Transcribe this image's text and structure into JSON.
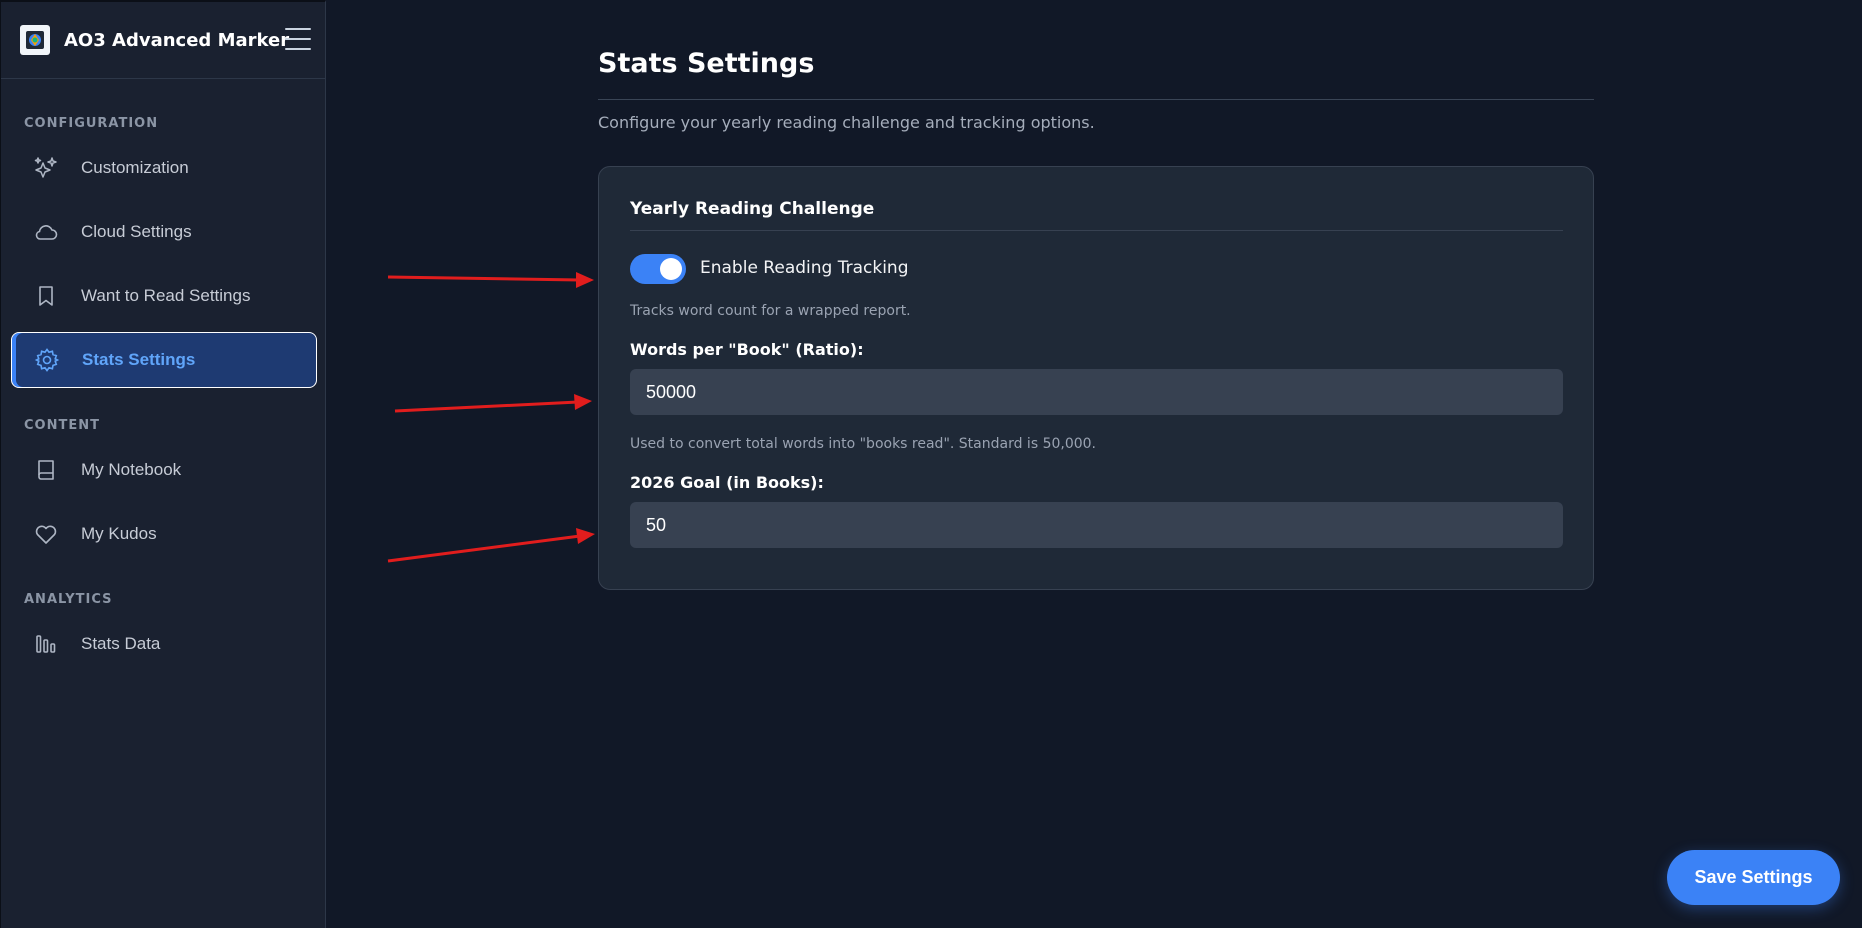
{
  "app": {
    "title": "AO3 Advanced Marker"
  },
  "sidebar": {
    "sections": [
      {
        "label": "CONFIGURATION",
        "items": [
          {
            "label": "Customization",
            "icon": "sparkles-icon"
          },
          {
            "label": "Cloud Settings",
            "icon": "cloud-icon"
          },
          {
            "label": "Want to Read Settings",
            "icon": "bookmark-icon"
          },
          {
            "label": "Stats Settings",
            "icon": "gear-icon",
            "active": true
          }
        ]
      },
      {
        "label": "CONTENT",
        "items": [
          {
            "label": "My Notebook",
            "icon": "book-icon"
          },
          {
            "label": "My Kudos",
            "icon": "heart-icon"
          }
        ]
      },
      {
        "label": "ANALYTICS",
        "items": [
          {
            "label": "Stats Data",
            "icon": "bar-chart-icon"
          }
        ]
      }
    ]
  },
  "main": {
    "title": "Stats Settings",
    "subtitle": "Configure your yearly reading challenge and tracking options.",
    "card": {
      "title": "Yearly Reading Challenge",
      "toggle": {
        "label": "Enable Reading Tracking",
        "enabled": true,
        "help": "Tracks word count for a wrapped report."
      },
      "ratio": {
        "label": "Words per \"Book\" (Ratio):",
        "value": "50000",
        "help": "Used to convert total words into \"books read\". Standard is 50,000."
      },
      "goal": {
        "label": "2026 Goal (in Books):",
        "value": "50"
      }
    }
  },
  "actions": {
    "save_label": "Save Settings"
  },
  "colors": {
    "accent": "#3b82f6",
    "background": "#111827",
    "sidebar": "#1a2130",
    "card": "#1f2937",
    "annotation_arrow": "#e11d1d"
  }
}
